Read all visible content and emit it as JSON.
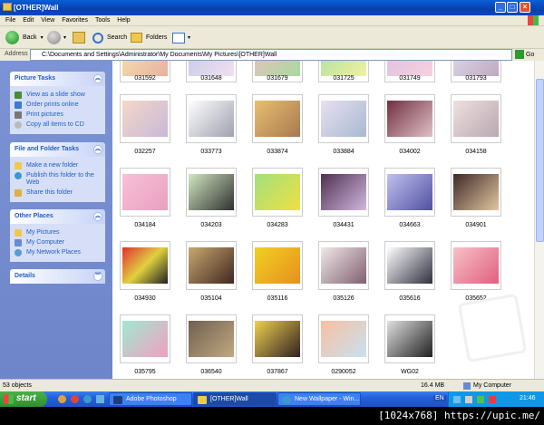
{
  "window": {
    "title": "[OTHER]Wall"
  },
  "menu": [
    "File",
    "Edit",
    "View",
    "Favorites",
    "Tools",
    "Help"
  ],
  "toolbar": {
    "back": "Back",
    "search": "Search",
    "folders": "Folders"
  },
  "address": {
    "label": "Address",
    "path": "C:\\Documents and Settings\\Administrator\\My Documents\\My Pictures\\[OTHER]Wall",
    "go": "Go"
  },
  "tasks": {
    "picture": {
      "header": "Picture Tasks",
      "items": [
        "View as a slide show",
        "Order prints online",
        "Print pictures",
        "Copy all items to CD"
      ]
    },
    "file": {
      "header": "File and Folder Tasks",
      "items": [
        "Make a new folder",
        "Publish this folder to the Web",
        "Share this folder"
      ]
    },
    "other": {
      "header": "Other Places",
      "items": [
        "My Pictures",
        "My Computer",
        "My Network Places"
      ]
    },
    "details": {
      "header": "Details"
    }
  },
  "files": {
    "row0": [
      "031592",
      "031648",
      "031679",
      "031725",
      "031749",
      "031793"
    ],
    "row1": [
      "032257",
      "033773",
      "033874",
      "033884",
      "034002",
      "034158"
    ],
    "row2": [
      "034184",
      "034203",
      "034283",
      "034431",
      "034663",
      "034901"
    ],
    "row3": [
      "034930",
      "035104",
      "035116",
      "035126",
      "035616",
      "035652"
    ],
    "row4": [
      "035795",
      "036540",
      "037867",
      "0290052",
      "WG02"
    ]
  },
  "status": {
    "objects": "53 objects",
    "size": "16.4 MB",
    "location": "My Computer"
  },
  "taskbar": {
    "start": "start",
    "tasks": [
      "Adobe Photoshop",
      "[OTHER]Wall",
      "New Wallpaper - Win..."
    ],
    "lang": "EN",
    "time": "21:46"
  },
  "watermark": "[1024x768] https://upic.me/"
}
